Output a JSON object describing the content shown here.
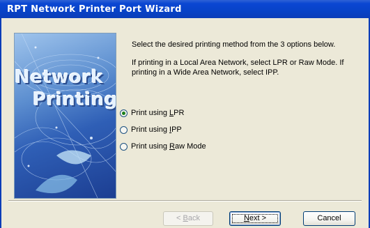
{
  "window": {
    "title": "RPT Network Printer Port Wizard"
  },
  "side_image": {
    "line1": "Network",
    "line2": "Printing"
  },
  "content": {
    "instruction1": "Select the desired printing method from the 3 options below.",
    "instruction2": "If printing in a Local Area Network, select LPR or Raw Mode. If printing in a Wide Area Network, select IPP."
  },
  "options": [
    {
      "prefix": "Print using ",
      "accel": "L",
      "rest": "PR",
      "selected": true
    },
    {
      "prefix": "Print using ",
      "accel": "I",
      "rest": "PP",
      "selected": false
    },
    {
      "prefix": "Print using ",
      "accel": "R",
      "rest": "aw Mode",
      "selected": false
    }
  ],
  "buttons": {
    "back": {
      "prefix": "< ",
      "accel": "B",
      "rest": "ack",
      "enabled": false
    },
    "next": {
      "prefix": "",
      "accel": "N",
      "rest": "ext >",
      "enabled": true
    },
    "cancel": {
      "label": "Cancel",
      "enabled": true
    }
  },
  "colors": {
    "titlebar": "#0A46D2",
    "dialog_bg": "#ECE9D8",
    "radio_dot": "#1A7F1A"
  }
}
